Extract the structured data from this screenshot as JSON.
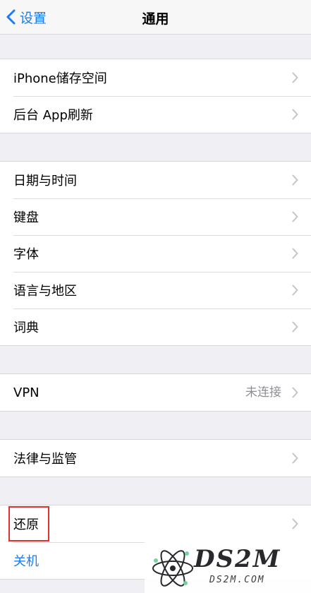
{
  "navbar": {
    "back_label": "设置",
    "title": "通用"
  },
  "groups": [
    {
      "items": [
        {
          "label": "iPhone储存空间"
        },
        {
          "label": "后台 App刷新"
        }
      ]
    },
    {
      "items": [
        {
          "label": "日期与时间"
        },
        {
          "label": "键盘"
        },
        {
          "label": "字体"
        },
        {
          "label": "语言与地区"
        },
        {
          "label": "词典"
        }
      ]
    },
    {
      "items": [
        {
          "label": "VPN",
          "value": "未连接"
        }
      ]
    },
    {
      "items": [
        {
          "label": "法律与监管"
        }
      ]
    },
    {
      "items": [
        {
          "label": "还原"
        },
        {
          "label": "关机"
        }
      ]
    }
  ],
  "watermark": {
    "logo": "DS2M",
    "url": "DS2M.COM"
  },
  "colors": {
    "accent": "#1a7cf3",
    "highlight": "#e0302f",
    "background": "#efeff4"
  }
}
